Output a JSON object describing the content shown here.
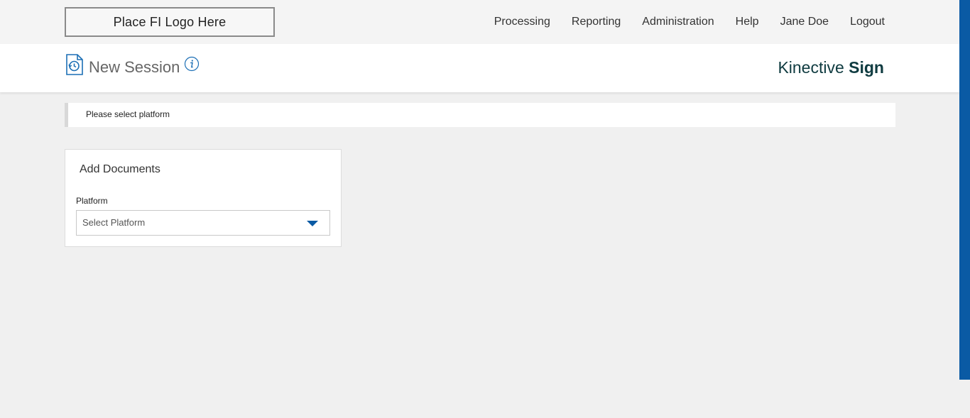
{
  "logo": {
    "text": "Place FI Logo Here"
  },
  "nav": {
    "items": [
      "Processing",
      "Reporting",
      "Administration",
      "Help",
      "Jane Doe",
      "Logout"
    ]
  },
  "header": {
    "title": "New Session",
    "brand_light": "Kinective",
    "brand_bold": "Sign"
  },
  "alert": {
    "message": "Please select platform"
  },
  "card": {
    "title": "Add Documents",
    "platform_label": "Platform",
    "platform_placeholder": "Select Platform"
  },
  "colors": {
    "accent": "#0a5aa4",
    "brand": "#0f3b40",
    "icon_blue": "#1c6fb5"
  },
  "icons": [
    "document-history-icon",
    "info-icon",
    "chevron-down-icon"
  ]
}
